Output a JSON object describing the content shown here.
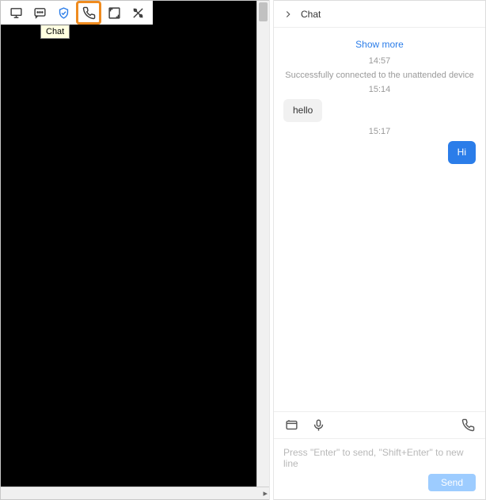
{
  "toolbar": {
    "tooltip": "Chat"
  },
  "chat": {
    "header_title": "Chat",
    "show_more": "Show more",
    "messages": [
      {
        "kind": "ts",
        "text": "14:57"
      },
      {
        "kind": "system",
        "text": "Successfully connected to the unattended device"
      },
      {
        "kind": "ts",
        "text": "15:14"
      },
      {
        "kind": "remote",
        "text": "hello"
      },
      {
        "kind": "ts",
        "text": "15:17"
      },
      {
        "kind": "mine",
        "text": "Hi"
      }
    ],
    "input_placeholder": "Press \"Enter\" to send, \"Shift+Enter\" to new line",
    "send_label": "Send"
  }
}
